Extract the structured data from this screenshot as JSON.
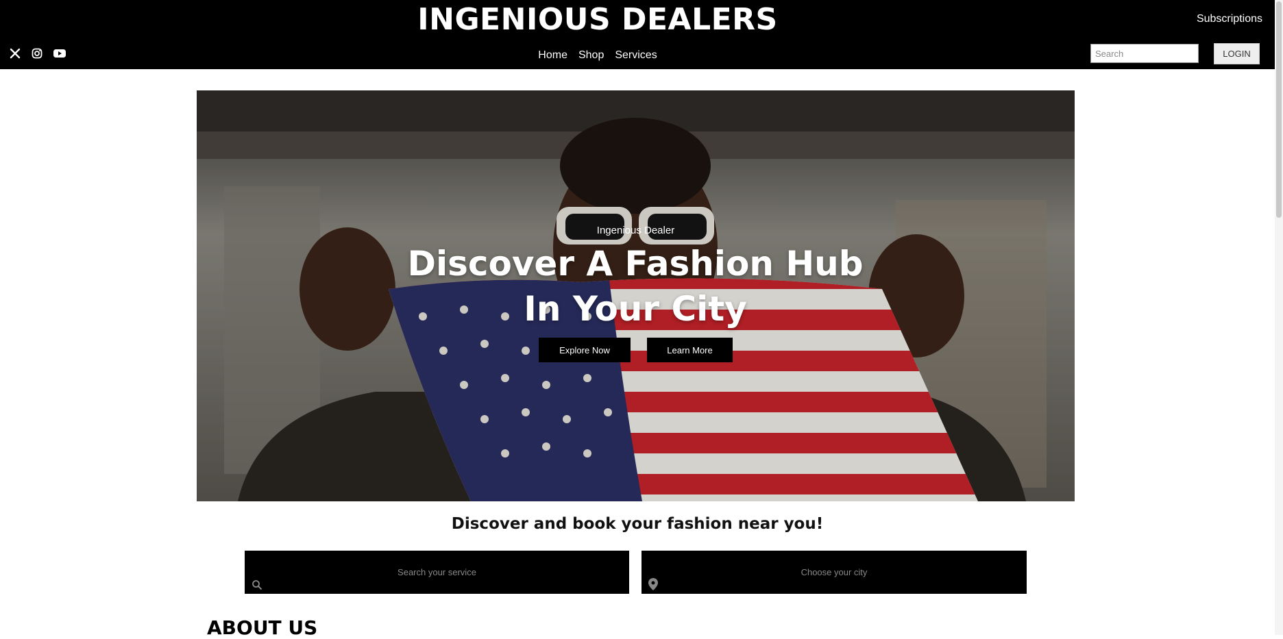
{
  "header": {
    "brand": "INGENIOUS DEALERS",
    "subscriptions_link": "Subscriptions",
    "nav": [
      "Home",
      "Shop",
      "Services"
    ],
    "search_placeholder": "Search",
    "login_label": "LOGIN",
    "social_icons": [
      "x-icon",
      "instagram-icon",
      "youtube-icon"
    ]
  },
  "hero": {
    "kicker": "Ingenious Dealer",
    "headline": "Discover A Fashion Hub In Your City",
    "explore_label": "Explore Now",
    "learn_label": "Learn More"
  },
  "discover": {
    "heading": "Discover and book your fashion near you!",
    "service_placeholder": "Search your service",
    "city_placeholder": "Choose your city"
  },
  "about": {
    "heading": "ABOUT US"
  },
  "colors": {
    "header_bg": "#000000",
    "accent": "#000000",
    "text_light": "#ffffff"
  }
}
